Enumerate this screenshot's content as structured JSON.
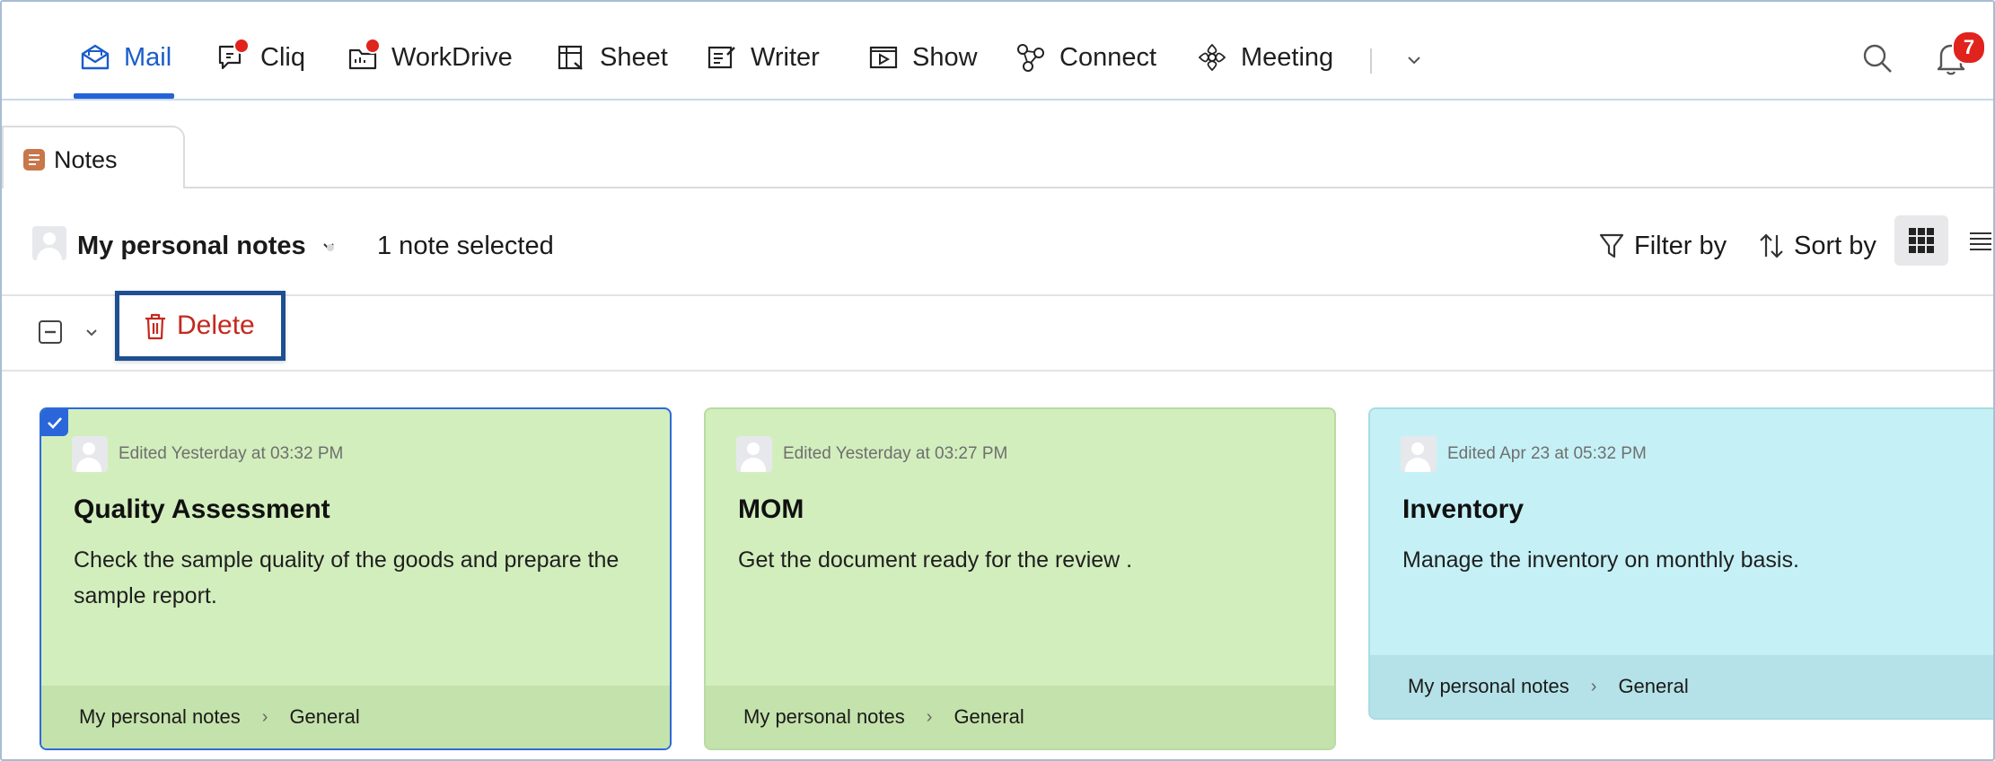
{
  "topbar": {
    "apps": [
      {
        "label": "Mail",
        "icon": "mail-icon",
        "active": true
      },
      {
        "label": "Cliq",
        "icon": "cliq-icon",
        "dot": true
      },
      {
        "label": "WorkDrive",
        "icon": "workdrive-icon",
        "dot": true
      },
      {
        "label": "Sheet",
        "icon": "sheet-icon"
      },
      {
        "label": "Writer",
        "icon": "writer-icon"
      },
      {
        "label": "Show",
        "icon": "show-icon"
      },
      {
        "label": "Connect",
        "icon": "connect-icon"
      },
      {
        "label": "Meeting",
        "icon": "meeting-icon"
      }
    ],
    "notification_count": "7"
  },
  "tab": {
    "label": "Notes"
  },
  "subheader": {
    "notebook": "My personal notes",
    "selection": "1 note selected",
    "filter_label": "Filter by",
    "sort_label": "Sort by"
  },
  "actions": {
    "delete_label": "Delete"
  },
  "notes": [
    {
      "edited": "Edited Yesterday at 03:32 PM",
      "title": "Quality Assessment",
      "body": "Check the sample quality of the goods and prepare the sample report.",
      "notebook": "My personal notes",
      "section": "General",
      "color": "#d2eebd",
      "footer_color": "#c4e2ab",
      "selected": true
    },
    {
      "edited": "Edited Yesterday at 03:27 PM",
      "title": "MOM",
      "body": "Get the document ready for the review .",
      "notebook": "My personal notes",
      "section": "General",
      "color": "#d2eebd",
      "footer_color": "#c4e2ab",
      "selected": false
    },
    {
      "edited": "Edited Apr 23 at 05:32 PM",
      "title": "Inventory",
      "body": "Manage the inventory on monthly basis.",
      "notebook": "My personal notes",
      "section": "General",
      "color": "#c5f1f6",
      "footer_color": "#b4e2e8",
      "selected": false
    }
  ],
  "colors": {
    "accent": "#2463d6",
    "delete": "#c4291d",
    "highlight_border": "#1e4f92",
    "badge": "#e0231c"
  }
}
